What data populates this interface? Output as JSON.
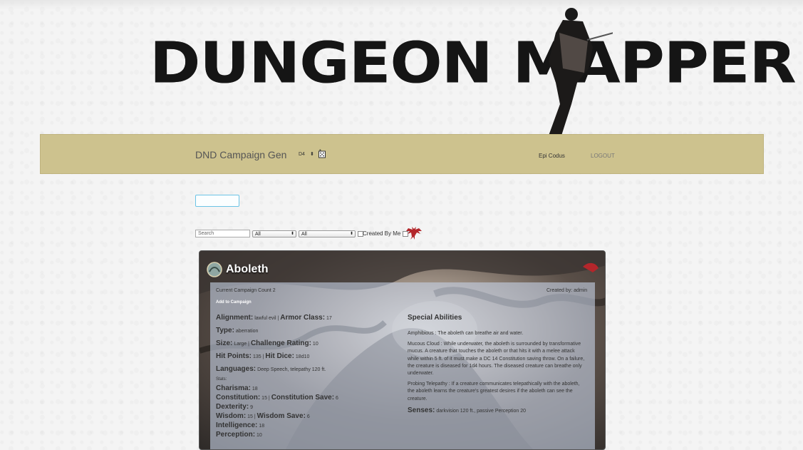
{
  "logo": {
    "text": "DUNGEON MAPPER"
  },
  "navbar": {
    "brand": "DND Campaign Gen",
    "dice_value": "D4",
    "user": "Epi Codus",
    "logout": "LOGOUT"
  },
  "filters": {
    "search_placeholder": "Search",
    "select1": "All",
    "select2": "All",
    "created_by_me": "Created By Me"
  },
  "monster": {
    "name": "Aboleth",
    "campaign_count": "Current Campaign Count 2",
    "created_by": "Created by: admin",
    "add_button": "Add to Campaign",
    "alignment_label": "Alignment",
    "alignment": "lawful evil",
    "armor_class_label": "Armor Class",
    "armor_class": "17",
    "type_label": "Type",
    "type": "aberration",
    "size_label": "Size",
    "size": "Large",
    "challenge_label": "Challenge Rating",
    "challenge": "10",
    "hp_label": "Hit Points",
    "hp": "135",
    "hit_dice_label": "Hit Dice",
    "hit_dice": "18d10",
    "languages_label": "Languages",
    "languages": "Deep Speech, telepathy 120 ft.",
    "stats_label": "Stats:",
    "charisma_label": "Charisma",
    "charisma": "18",
    "constitution_label": "Constitution",
    "constitution": "15",
    "con_save_label": "Constitution Save",
    "con_save": "6",
    "dexterity_label": "Dexterity",
    "dexterity": "9",
    "wisdom_label": "Wisdom",
    "wisdom": "15",
    "wis_save_label": "Wisdom Save",
    "wis_save": "6",
    "intelligence_label": "Intelligence",
    "intelligence": "18",
    "perception_label": "Perception",
    "perception": "10",
    "special_title": "Special Abilities",
    "ability1": "Amphibious : The aboleth can breathe air and water.",
    "ability2": "Mucous Cloud : While underwater, the aboleth is surrounded by transformative mucus. A creature that touches the aboleth or that hits it with a melee attack while within 5 ft. of it must make a DC 14 Constitution saving throw. On a failure, the creature is diseased for 1d4 hours. The diseased creature can breathe only underwater.",
    "ability3": "Probing Telepathy : If a creature communicates telepathically with the aboleth, the aboleth learns the creature's greatest desires if the aboleth can see the creature.",
    "senses_label": "Senses",
    "senses": "darkvision 120 ft., passive Perception 20"
  },
  "colors": {
    "navbar": "#cdc28e",
    "accent_border": "#6cc4e6",
    "dragon": "#b3262b"
  },
  "icons": [
    "dice-icon",
    "dragon-icon",
    "monster-portrait-icon",
    "select-arrow-icon"
  ]
}
